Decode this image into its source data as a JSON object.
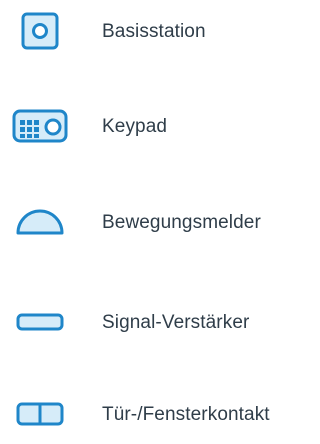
{
  "colors": {
    "icon_stroke": "#1f86c9",
    "icon_fill": "#d6ecf9",
    "label_text": "#2f3d49"
  },
  "devices": [
    {
      "label": "Basisstation",
      "icon": "base-station-icon"
    },
    {
      "label": "Keypad",
      "icon": "keypad-icon"
    },
    {
      "label": "Bewegungsmelder",
      "icon": "motion-detector-icon"
    },
    {
      "label": "Signal-Verstärker",
      "icon": "signal-repeater-icon"
    },
    {
      "label": "Tür-/Fensterkontakt",
      "icon": "door-window-contact-icon"
    }
  ]
}
